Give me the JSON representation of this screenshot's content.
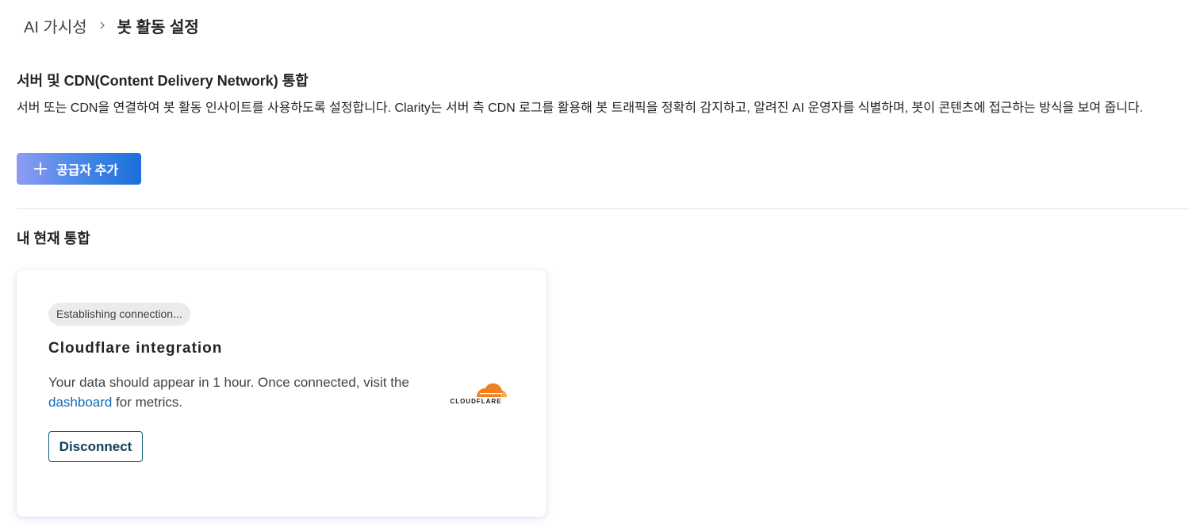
{
  "breadcrumb": {
    "parent": "AI 가시성",
    "current": "봇 활동 설정"
  },
  "integration_section": {
    "title": "서버 및 CDN(Content Delivery Network) 통합",
    "description": "서버 또는 CDN을 연결하여 봇 활동 인사이트를 사용하도록 설정합니다. Clarity는 서버 측 CDN 로그를 활용해 봇 트래픽을 정확히 감지하고, 알려진 AI 운영자를 식별하며, 봇이 콘텐츠에 접근하는 방식을 보여 줍니다.",
    "add_provider_label": "공급자 추가"
  },
  "current_integrations": {
    "title": "내 현재 통합",
    "cards": [
      {
        "status": "Establishing connection...",
        "title": "Cloudflare integration",
        "body_before_link": "Your data should appear in 1 hour. Once connected, visit the ",
        "link_text": "dashboard",
        "body_after_link": " for metrics.",
        "logo_text": "CLOUDFLARE",
        "disconnect_label": "Disconnect"
      }
    ]
  },
  "colors": {
    "accent_blue": "#1b6fdb",
    "link_blue": "#0f6cbd",
    "cloudflare_orange": "#f38020",
    "cloudflare_light_orange": "#faae40"
  },
  "icons": {
    "breadcrumb_separator": "chevron-right-icon",
    "add_button": "plus-icon",
    "logo": "cloudflare-logo-icon"
  }
}
